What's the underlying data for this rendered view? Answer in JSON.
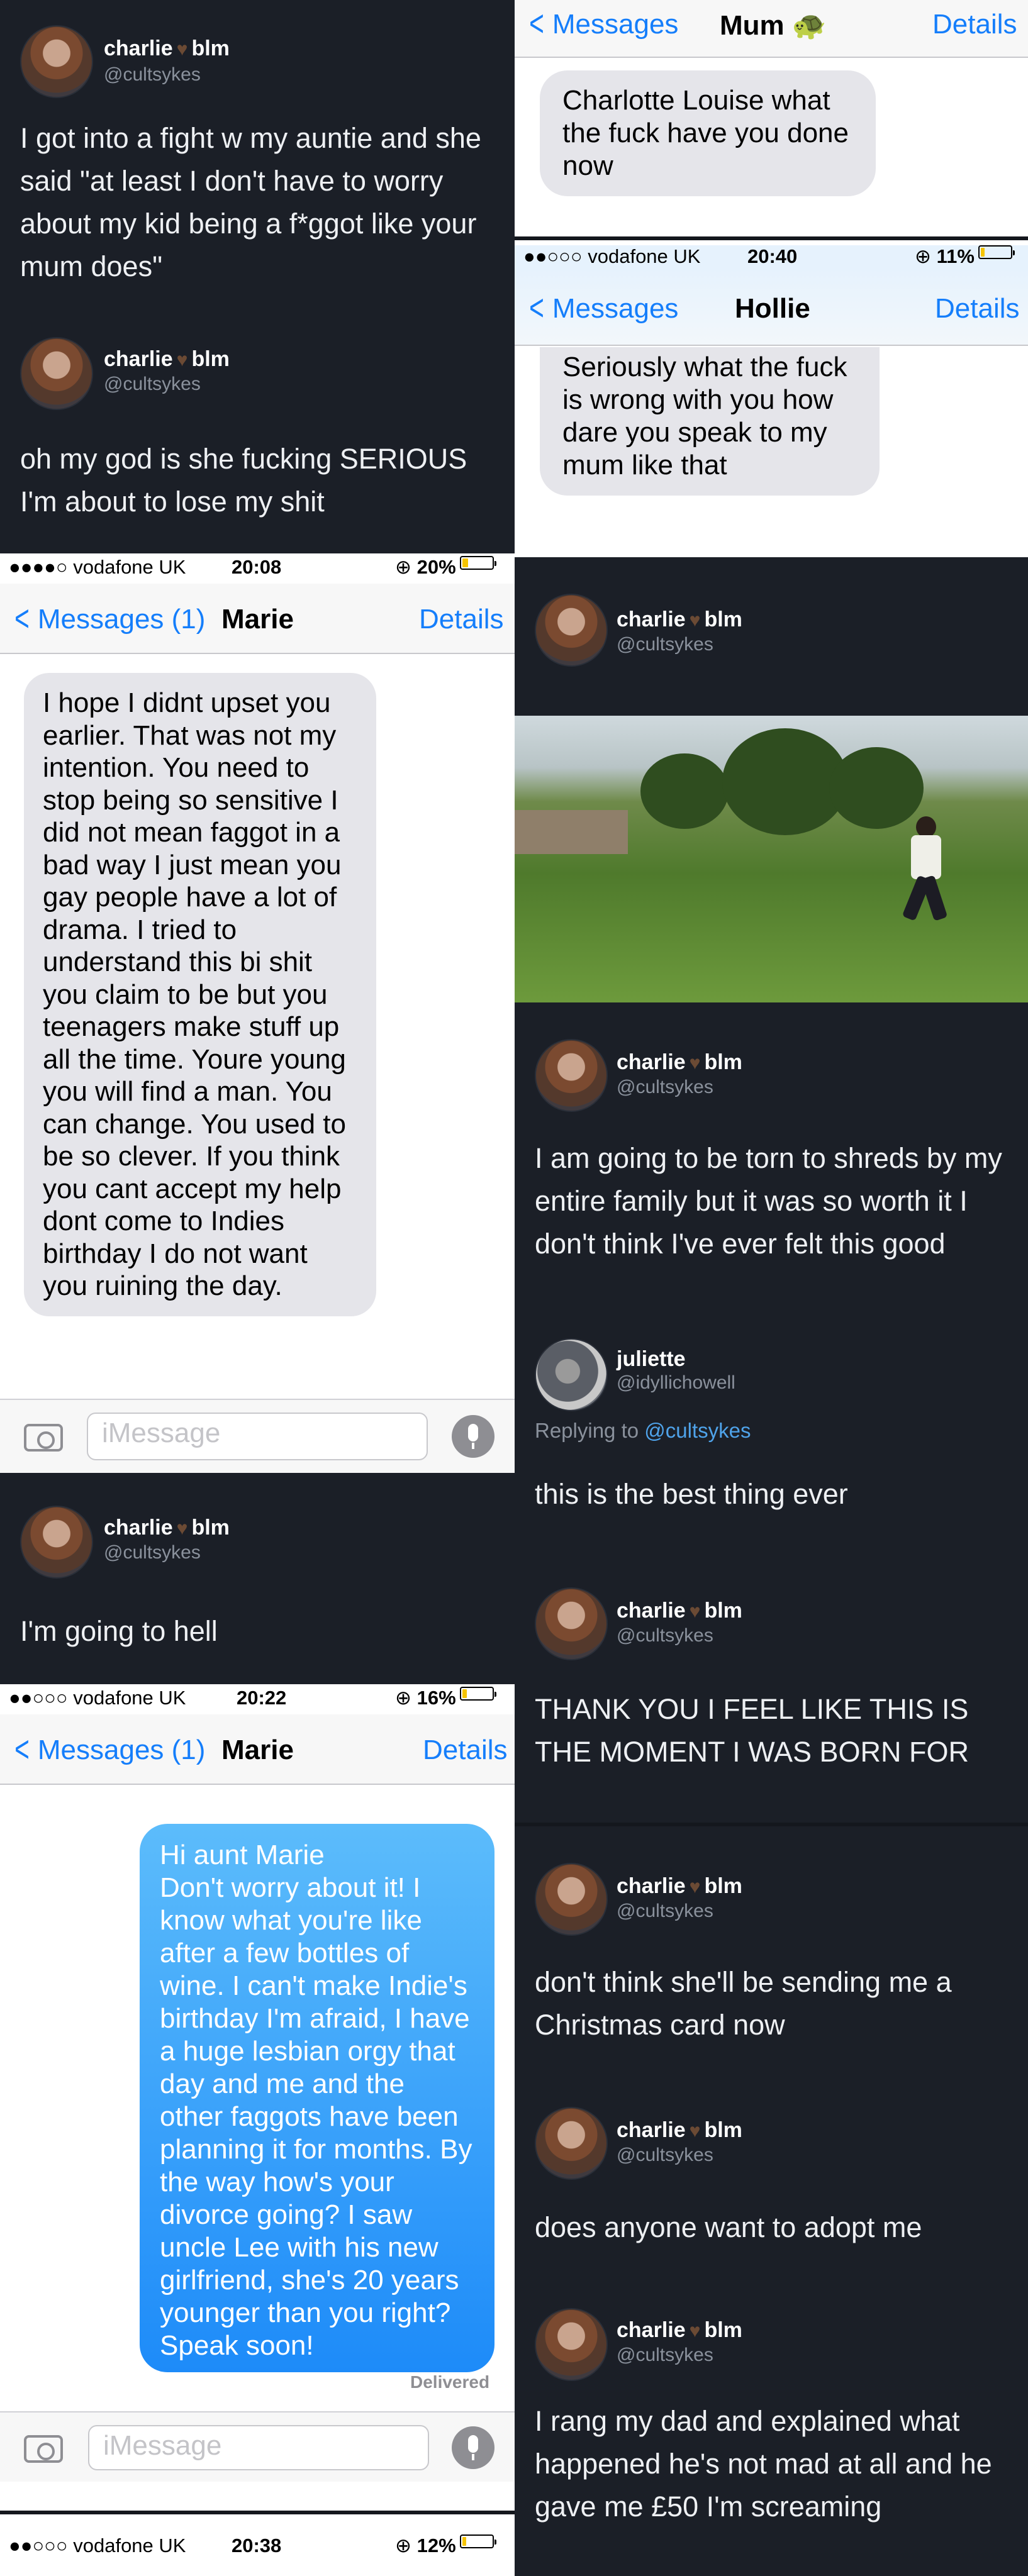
{
  "tweets": {
    "t1": {
      "name": "charlie",
      "badge": "blm",
      "handle": "@cultsykes",
      "text": "I got into a fight w my auntie and she said \"at least I don't have to worry about my kid being a f*ggot like your mum does\""
    },
    "t2": {
      "name": "charlie",
      "badge": "blm",
      "handle": "@cultsykes",
      "text": "oh my god is she fucking SERIOUS I'm about to lose my shit"
    },
    "t3": {
      "name": "charlie",
      "badge": "blm",
      "handle": "@cultsykes"
    },
    "t4": {
      "name": "charlie",
      "badge": "blm",
      "handle": "@cultsykes",
      "text": "I am going to be torn to shreds by my entire family but it was so worth it I don't think I've ever felt this good"
    },
    "t5": {
      "name": "juliette",
      "handle": "@idyllichowell",
      "replying_prefix": "Replying to",
      "replying_to": "@cultsykes",
      "text": "this is the best thing ever"
    },
    "t6": {
      "name": "charlie",
      "badge": "blm",
      "handle": "@cultsykes",
      "text": "THANK YOU I FEEL LIKE THIS IS THE MOMENT I WAS BORN FOR"
    },
    "t7": {
      "name": "charlie",
      "badge": "blm",
      "handle": "@cultsykes",
      "text": "I'm going to hell"
    },
    "t8": {
      "name": "charlie",
      "badge": "blm",
      "handle": "@cultsykes",
      "text": "don't think she'll be sending me a Christmas card now"
    },
    "t9": {
      "name": "charlie",
      "badge": "blm",
      "handle": "@cultsykes",
      "text": "does anyone want to adopt me"
    },
    "t10": {
      "name": "charlie",
      "badge": "blm",
      "handle": "@cultsykes",
      "text": "I rang my dad and explained what happened he's not mad at all and he gave me £50 I'm screaming"
    }
  },
  "sms_mum": {
    "back": "Messages",
    "title": "Mum 🐢",
    "details": "Details",
    "message": "Charlotte Louise what the fuck have you done now"
  },
  "sms_hollie": {
    "carrier": "●●○○○ vodafone UK",
    "time": "20:40",
    "battery": "11%",
    "battery_level": 0.11,
    "back": "Messages",
    "title": "Hollie",
    "details": "Details",
    "message": "Seriously what the fuck is wrong with you how dare you speak to my mum like that"
  },
  "sms_marie1": {
    "carrier": "●●●●○ vodafone UK",
    "time": "20:08",
    "battery": "20%",
    "battery_level": 0.2,
    "back": "Messages (1)",
    "title": "Marie",
    "details": "Details",
    "message": "I hope I didnt upset you earlier. That was not my intention. You need to stop being so sensitive I did not mean faggot in a bad way I just mean you gay people have a lot of drama. I tried to understand this bi shit you claim to be but you teenagers make stuff up all the time. Youre young you will find a man. You can change. You used to be so clever. If you think you cant accept my help dont come to Indies birthday I do not want you ruining the day.",
    "input_placeholder": "iMessage"
  },
  "sms_marie2": {
    "carrier": "●●○○○ vodafone UK",
    "time": "20:22",
    "battery": "16%",
    "battery_level": 0.16,
    "back": "Messages (1)",
    "title": "Marie",
    "details": "Details",
    "message": "Hi aunt Marie\nDon't worry about it! I know what you're like after a few bottles of wine. I can't make Indie's birthday I'm afraid, I have a huge lesbian orgy that day and me and the other faggots have been planning it for months. By the way how's your divorce going? I saw uncle Lee with his new girlfriend, she's 20 years younger than you right? Speak soon!",
    "delivered": "Delivered",
    "input_placeholder": "iMessage"
  },
  "sms_last": {
    "carrier": "●●○○○ vodafone UK",
    "time": "20:38",
    "battery": "12%",
    "battery_level": 0.12
  }
}
